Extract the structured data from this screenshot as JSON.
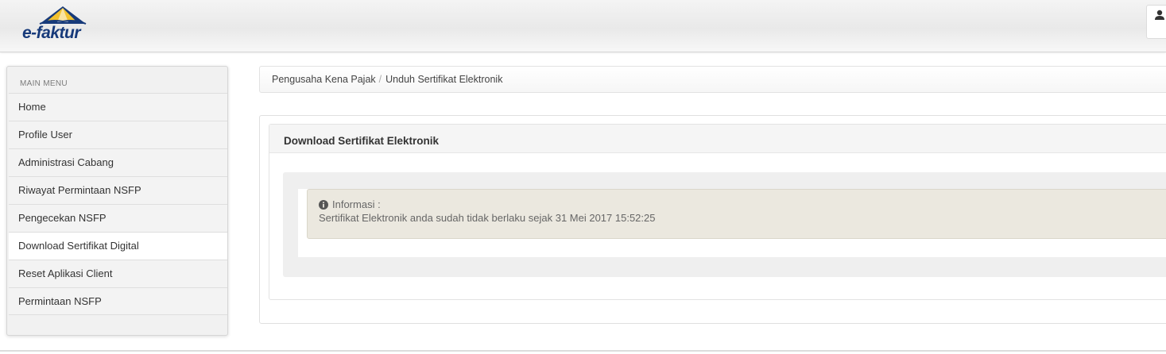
{
  "header": {
    "logo_text": "e-faktur"
  },
  "sidebar": {
    "title": "MAIN MENU",
    "items": [
      {
        "label": "Home"
      },
      {
        "label": "Profile User"
      },
      {
        "label": "Administrasi Cabang"
      },
      {
        "label": "Riwayat Permintaan NSFP"
      },
      {
        "label": "Pengecekan NSFP"
      },
      {
        "label": "Download Sertifikat Digital"
      },
      {
        "label": "Reset Aplikasi Client"
      },
      {
        "label": "Permintaan NSFP"
      }
    ],
    "active_index": 5
  },
  "breadcrumb": {
    "items": [
      "Pengusaha Kena Pajak",
      "Unduh Sertifikat Elektronik"
    ],
    "separator": "/"
  },
  "panel": {
    "title": "Download Sertifikat Elektronik",
    "info": {
      "icon": "info-circle-icon",
      "heading": "Informasi :",
      "message": "Sertifikat Elektronik anda sudah tidak berlaku sejak 31 Mei 2017 15:52:25"
    }
  },
  "colors": {
    "logo_blue": "#173a7a",
    "logo_yellow": "#f2c230",
    "info_bg": "#ebe8df"
  }
}
